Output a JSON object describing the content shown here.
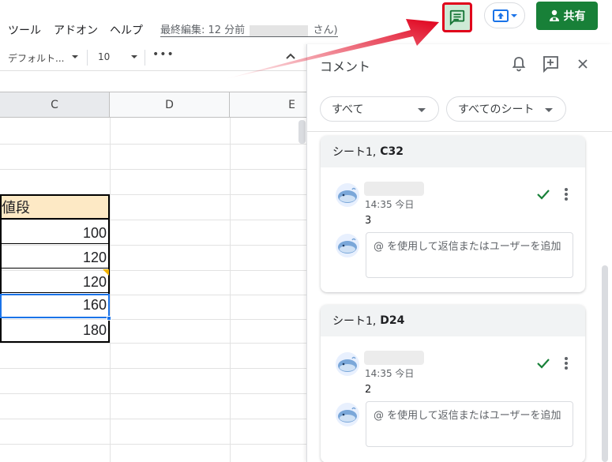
{
  "menubar": {
    "items": [
      "ツール",
      "アドオン",
      "ヘルプ"
    ],
    "last_edit_prefix": "最終編集: 12 分前",
    "last_edit_suffix": "さん)",
    "share_label": "共有"
  },
  "toolbar": {
    "font_name": "デフォルト...",
    "font_size": "10",
    "more": "•••"
  },
  "grid": {
    "columns": [
      "C",
      "D",
      "E"
    ],
    "header_cell": "値段",
    "values": [
      "100",
      "120",
      "120",
      "160",
      "180"
    ]
  },
  "comments_panel": {
    "title": "コメント",
    "filter_all": "すべて",
    "filter_sheets": "すべてのシート",
    "threads": [
      {
        "location_sheet": "シート1,",
        "location_cell": "C32",
        "time": "14:35 今日",
        "body": "3",
        "reply_placeholder": "@ を使用して返信またはユーザーを追加"
      },
      {
        "location_sheet": "シート1,",
        "location_cell": "D24",
        "time": "14:35 今日",
        "body": "2",
        "reply_placeholder": "@ を使用して返信またはユーザーを追加"
      }
    ]
  },
  "colors": {
    "share_green": "#188038",
    "highlight_red": "#e0001b",
    "header_fill": "#fde9c5",
    "selection_blue": "#1a73e8",
    "check_green": "#188038"
  }
}
